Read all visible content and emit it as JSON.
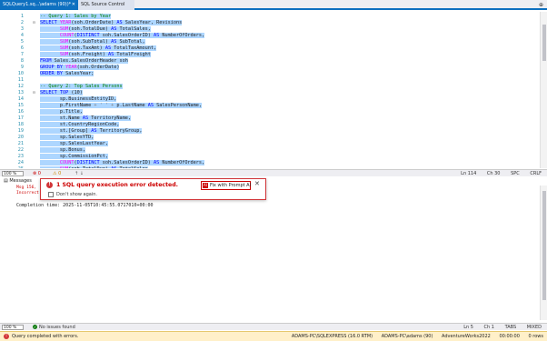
{
  "tabs": {
    "active_label": "SQLQuery1.sq...\\adams (90))*",
    "inactive_label": "SQL Source Control",
    "active_close": "✕",
    "pin": "⊕"
  },
  "editor": {
    "lines": [
      {
        "num": "1",
        "fold": "",
        "parts": [
          {
            "t": "-- Query 1: Sales by Year",
            "c": "cm"
          }
        ]
      },
      {
        "num": "2",
        "fold": "⊟",
        "parts": [
          {
            "t": "SELECT ",
            "c": "kw"
          },
          {
            "t": "YEAR",
            "c": "fn"
          },
          {
            "t": "(soh.OrderDate) ",
            "c": "tx"
          },
          {
            "t": "AS ",
            "c": "kw"
          },
          {
            "t": "SalesYear, Revisions",
            "c": "tx"
          }
        ]
      },
      {
        "num": "3",
        "fold": "",
        "parts": [
          {
            "t": "       ",
            "c": "tx"
          },
          {
            "t": "SUM",
            "c": "fn"
          },
          {
            "t": "(soh.TotalDue) ",
            "c": "tx"
          },
          {
            "t": "AS ",
            "c": "kw"
          },
          {
            "t": "TotalSales,",
            "c": "tx"
          }
        ]
      },
      {
        "num": "4",
        "fold": "",
        "parts": [
          {
            "t": "       ",
            "c": "tx"
          },
          {
            "t": "COUNT",
            "c": "fn"
          },
          {
            "t": "(",
            "c": "tx"
          },
          {
            "t": "DISTINCT ",
            "c": "kw"
          },
          {
            "t": "soh.SalesOrderID) ",
            "c": "tx"
          },
          {
            "t": "AS ",
            "c": "kw"
          },
          {
            "t": "NumberOfOrders,",
            "c": "tx"
          }
        ]
      },
      {
        "num": "5",
        "fold": "",
        "parts": [
          {
            "t": "       ",
            "c": "tx"
          },
          {
            "t": "SUM",
            "c": "fn"
          },
          {
            "t": "(soh.SubTotal) ",
            "c": "tx"
          },
          {
            "t": "AS ",
            "c": "kw"
          },
          {
            "t": "SubTotal,",
            "c": "tx"
          }
        ]
      },
      {
        "num": "6",
        "fold": "",
        "parts": [
          {
            "t": "       ",
            "c": "tx"
          },
          {
            "t": "SUM",
            "c": "fn"
          },
          {
            "t": "(soh.TaxAmt) ",
            "c": "tx"
          },
          {
            "t": "AS ",
            "c": "kw"
          },
          {
            "t": "TotalTaxAmount,",
            "c": "tx"
          }
        ]
      },
      {
        "num": "7",
        "fold": "",
        "parts": [
          {
            "t": "       ",
            "c": "tx"
          },
          {
            "t": "SUM",
            "c": "fn"
          },
          {
            "t": "(soh.Freight) ",
            "c": "tx"
          },
          {
            "t": "AS ",
            "c": "kw"
          },
          {
            "t": "TotalFreight",
            "c": "tx"
          }
        ]
      },
      {
        "num": "8",
        "fold": "",
        "parts": [
          {
            "t": "FROM ",
            "c": "kw"
          },
          {
            "t": "Sales.SalesOrderHeader soh",
            "c": "tx"
          }
        ]
      },
      {
        "num": "9",
        "fold": "",
        "parts": [
          {
            "t": "GROUP BY ",
            "c": "kw"
          },
          {
            "t": "YEAR",
            "c": "fn"
          },
          {
            "t": "(soh.OrderDate)",
            "c": "tx"
          }
        ]
      },
      {
        "num": "10",
        "fold": "",
        "parts": [
          {
            "t": "ORDER BY ",
            "c": "kw"
          },
          {
            "t": "SalesYear;",
            "c": "tx"
          }
        ]
      },
      {
        "num": "11",
        "fold": "",
        "parts": []
      },
      {
        "num": "12",
        "fold": "",
        "parts": [
          {
            "t": "-- Query 2: Top Sales Persons",
            "c": "cm"
          }
        ]
      },
      {
        "num": "13",
        "fold": "⊟",
        "parts": [
          {
            "t": "SELECT TOP ",
            "c": "kw"
          },
          {
            "t": "(10)",
            "c": "tx"
          }
        ]
      },
      {
        "num": "14",
        "fold": "",
        "parts": [
          {
            "t": "       sp.BusinessEntityID,",
            "c": "tx"
          }
        ]
      },
      {
        "num": "15",
        "fold": "",
        "parts": [
          {
            "t": "       p.FirstName ",
            "c": "tx"
          },
          {
            "t": "+ ' ' +",
            "c": "gr"
          },
          {
            "t": " p.LastName ",
            "c": "tx"
          },
          {
            "t": "AS ",
            "c": "kw"
          },
          {
            "t": "SalesPersonName,",
            "c": "tx"
          }
        ]
      },
      {
        "num": "16",
        "fold": "",
        "parts": [
          {
            "t": "       p.Title,",
            "c": "tx"
          }
        ]
      },
      {
        "num": "17",
        "fold": "",
        "parts": [
          {
            "t": "       st.",
            "c": "tx"
          },
          {
            "t": "Name ",
            "c": "tx"
          },
          {
            "t": "AS ",
            "c": "kw"
          },
          {
            "t": "TerritoryName,",
            "c": "tx"
          }
        ]
      },
      {
        "num": "18",
        "fold": "",
        "parts": [
          {
            "t": "       st.CountryRegionCode,",
            "c": "tx"
          }
        ]
      },
      {
        "num": "19",
        "fold": "",
        "parts": [
          {
            "t": "       st.[Group] ",
            "c": "tx"
          },
          {
            "t": "AS ",
            "c": "kw"
          },
          {
            "t": "TerritoryGroup,",
            "c": "tx"
          }
        ]
      },
      {
        "num": "20",
        "fold": "",
        "parts": [
          {
            "t": "       sp.SalesYTD,",
            "c": "tx"
          }
        ]
      },
      {
        "num": "21",
        "fold": "",
        "parts": [
          {
            "t": "       sp.SalesLastYear,",
            "c": "tx"
          }
        ]
      },
      {
        "num": "22",
        "fold": "",
        "parts": [
          {
            "t": "       sp.Bonus,",
            "c": "tx"
          }
        ]
      },
      {
        "num": "23",
        "fold": "",
        "parts": [
          {
            "t": "       sp.CommissionPct,",
            "c": "tx"
          }
        ]
      },
      {
        "num": "24",
        "fold": "",
        "parts": [
          {
            "t": "       ",
            "c": "tx"
          },
          {
            "t": "COUNT",
            "c": "fn"
          },
          {
            "t": "(",
            "c": "tx"
          },
          {
            "t": "DISTINCT ",
            "c": "kw"
          },
          {
            "t": "soh.SalesOrderID) ",
            "c": "tx"
          },
          {
            "t": "AS ",
            "c": "kw"
          },
          {
            "t": "NumberOfOrders,",
            "c": "tx"
          }
        ]
      },
      {
        "num": "25",
        "fold": "",
        "parts": [
          {
            "t": "       ",
            "c": "tx"
          },
          {
            "t": "SUM",
            "c": "fn"
          },
          {
            "t": "(soh.TotalDue) ",
            "c": "tx"
          },
          {
            "t": "AS ",
            "c": "kw"
          },
          {
            "t": "TotalSales",
            "c": "tx"
          }
        ]
      }
    ]
  },
  "editor_status": {
    "zoom": "100 %",
    "errors": "0",
    "warnings": "0",
    "arrows": "↑  ↓",
    "ln": "Ln 114",
    "ch": "Ch 30",
    "mode": "SPC",
    "eol": "CRLF"
  },
  "results": {
    "tab_label": "Messages",
    "error_lines": [
      "Msg 156,",
      "Incorrect"
    ],
    "completion": "Completion time: 2025-11-05T10:45:55.0717010+00:00"
  },
  "popup": {
    "icon": "!",
    "title": "1 SQL query execution error detected.",
    "fix_button": "Fix with Prompt AI",
    "fix_icon": "AI",
    "close": "✕",
    "checkbox_label": "Don't show again."
  },
  "results_status": {
    "zoom": "100 %",
    "check": "✓",
    "no_issues": "No issues found",
    "ln": "Ln 5",
    "ch": "Ch 1",
    "mode": "TABS",
    "eol": "MIXED"
  },
  "app_status": {
    "icon": "!",
    "left": "Query completed with errors.",
    "server": "ADAMS-PC\\SQLEXPRESS (16.0 RTM)",
    "user": "ADAMS-PC\\adams (90)",
    "database": "AdventureWorks2022",
    "time": "00:00:00",
    "rows": "0 rows"
  },
  "colors": {
    "accent": "#0e70c0",
    "selection": "#add6ff",
    "error": "#d13438",
    "status_bar": "#fff0c9"
  }
}
